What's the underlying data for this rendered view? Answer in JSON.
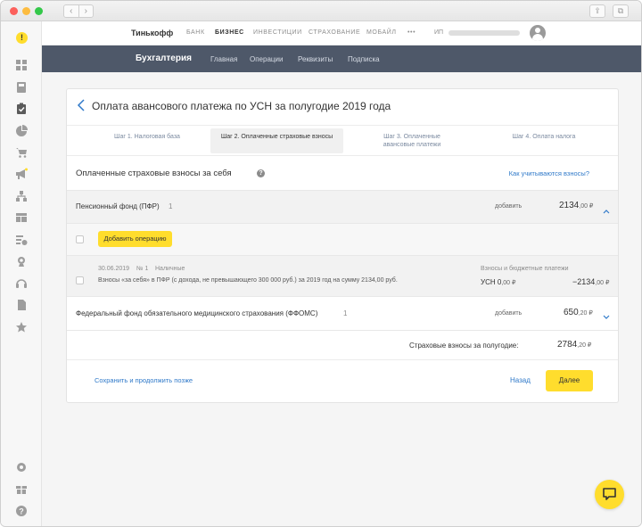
{
  "browser": {
    "nav_back": "‹",
    "nav_forward": "›",
    "share_icon": "⇪",
    "tabs_icon": "⧉"
  },
  "sidebar": {
    "logo": "!",
    "accent": "#ffdd2d"
  },
  "topnav": {
    "brand": "Тинькофф",
    "items": [
      "БАНК",
      "БИЗНЕС",
      "ИНВЕСТИЦИИ",
      "СТРАХОВАНИЕ",
      "МОБАЙЛ",
      "•••"
    ],
    "active": "БИЗНЕС",
    "user_prefix": "ИП"
  },
  "subnav": {
    "title": "Бухгалтерия",
    "items": [
      "Главная",
      "Операции",
      "Реквизиты",
      "Подписка"
    ],
    "bg": "#4e5869"
  },
  "page": {
    "title": "Оплата авансового платежа по УСН за полугодие 2019 года",
    "steps": [
      {
        "label": "Шаг 1. Налоговая база"
      },
      {
        "label": "Шаг 2. Оплаченные страховые взносы",
        "active": true
      },
      {
        "label": "Шаг 3. Оплаченные авансовые платежи"
      },
      {
        "label": "Шаг 4. Оплата налога"
      }
    ],
    "section_title": "Оплаченные страховые взносы за себя",
    "help_link": "Как учитываются взносы?",
    "pfr": {
      "label": "Пенсионный фонд (ПФР)",
      "count": "1",
      "add": "добавить",
      "amount_int": "2134",
      "amount_dec": ",00 ₽"
    },
    "add_operation": "Добавить операцию",
    "operation": {
      "date": "30.06.2019",
      "number": "№ 1",
      "type": "Наличные",
      "description": "Взносы «за себя» в ПФР (с дохода, не превышающего 300 000 руб.) за 2019 год на сумму 2134,00 руб.",
      "category": "Взносы и бюджетные платежи",
      "usn_label": "УСН",
      "usn_value": "0",
      "usn_dec": ",00 ₽",
      "amount": "−2134",
      "amount_dec": ",00 ₽"
    },
    "ffoms": {
      "label": "Федеральный фонд обязательного медицинского страхования (ФФОМС)",
      "count": "1",
      "add": "добавить",
      "amount_int": "650",
      "amount_dec": ",20 ₽"
    },
    "total": {
      "label": "Страховые взносы за полугодие:",
      "amount_int": "2784",
      "amount_dec": ",20 ₽"
    },
    "footer": {
      "save_later": "Сохранить и продолжить позже",
      "back": "Назад",
      "next": "Далее"
    }
  }
}
